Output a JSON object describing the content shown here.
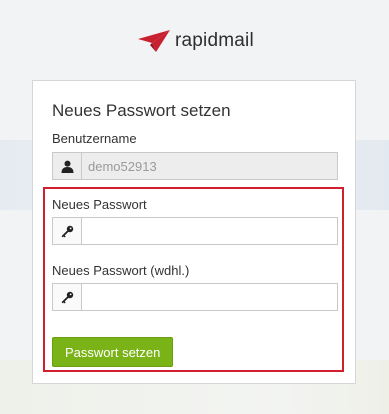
{
  "brand": {
    "name": "rapidmail",
    "accent_color": "#c8202f"
  },
  "form": {
    "title": "Neues Passwort setzen",
    "username": {
      "label": "Benutzername",
      "value": "demo52913",
      "icon": "user-icon",
      "disabled": true
    },
    "new_password": {
      "label": "Neues Passwort",
      "value": "",
      "icon": "key-icon"
    },
    "confirm_password": {
      "label": "Neues Passwort (wdhl.)",
      "value": "",
      "icon": "key-icon"
    },
    "submit_label": "Passwort setzen",
    "submit_color": "#7ab317"
  },
  "highlight_color": "#d0202f"
}
